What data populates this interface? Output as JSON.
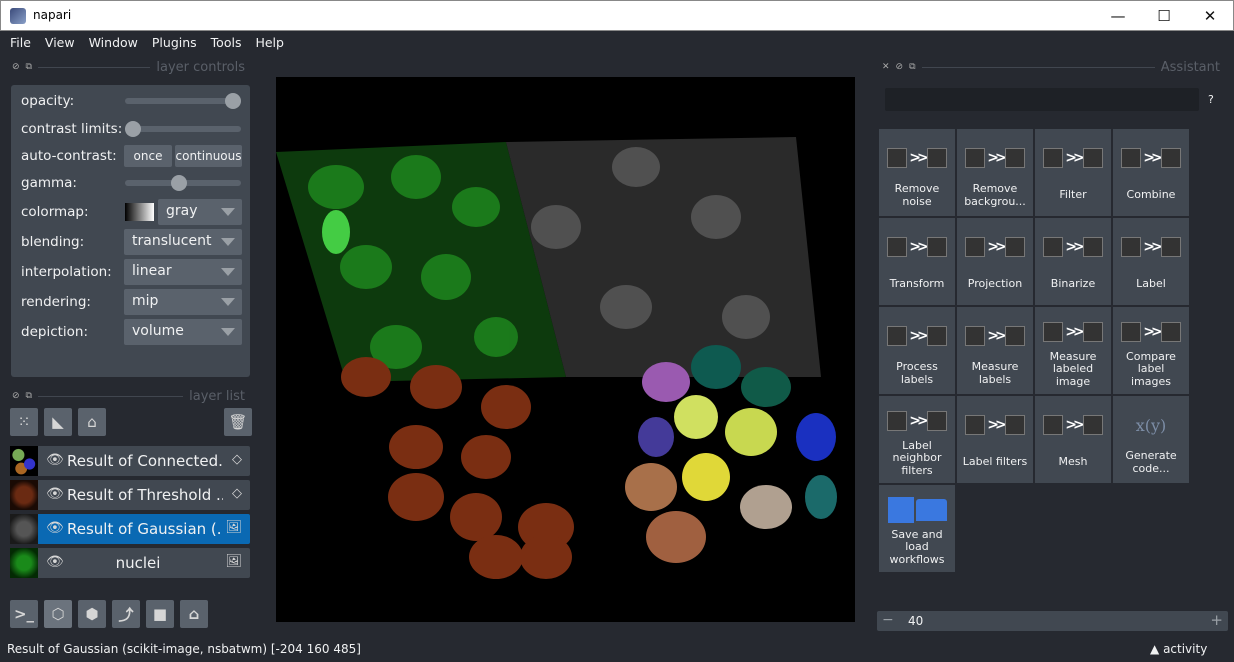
{
  "window": {
    "title": "napari",
    "minimize": "—",
    "maximize": "☐",
    "close": "✕"
  },
  "menu": [
    "File",
    "View",
    "Window",
    "Plugins",
    "Tools",
    "Help"
  ],
  "layer_controls": {
    "title": "layer controls",
    "opacity_label": "opacity:",
    "opacity": 1.0,
    "contrast_label": "contrast limits:",
    "contrast_low": 0.0,
    "auto_contrast_label": "auto-contrast:",
    "once": "once",
    "continuous": "continuous",
    "gamma_label": "gamma:",
    "gamma": 0.5,
    "colormap_label": "colormap:",
    "colormap": "gray",
    "blending_label": "blending:",
    "blending": "translucent",
    "interpolation_label": "interpolation:",
    "interpolation": "linear",
    "rendering_label": "rendering:",
    "rendering": "mip",
    "depiction_label": "depiction:",
    "depiction": "volume"
  },
  "layer_list": {
    "title": "layer list",
    "layers": [
      {
        "name": "Result of Connected...",
        "type": "labels-icon",
        "selected": false
      },
      {
        "name": "Result of Threshold ...",
        "type": "labels-icon",
        "selected": false
      },
      {
        "name": "Result of Gaussian (...",
        "type": "image-icon",
        "selected": true
      },
      {
        "name": "nuclei",
        "type": "image-icon",
        "selected": false
      }
    ]
  },
  "assistant": {
    "title": "Assistant",
    "help": "?",
    "tiles": [
      "Remove\nnoise",
      "Remove\nbackgrou...",
      "Filter",
      "Combine",
      "Transform",
      "Projection",
      "Binarize",
      "Label",
      "Process\nlabels",
      "Measure\nlabels",
      "Measure\nlabeled\nimage",
      "Compare\nlabel\nimages",
      "Label\nneighbor\nfilters",
      "Label filters",
      "Mesh",
      "Generate\ncode...",
      "Save and\nload\nworkflows"
    ],
    "code_glyph": "x(y)"
  },
  "spinbox": {
    "value": "40",
    "minus": "−",
    "plus": "+"
  },
  "status": {
    "text": "Result of Gaussian (scikit-image, nsbatwm) [-204  160  485]",
    "activity": "activity"
  },
  "colors": {
    "selected": "#0a69b3",
    "panel": "#414851",
    "bg": "#262930"
  }
}
